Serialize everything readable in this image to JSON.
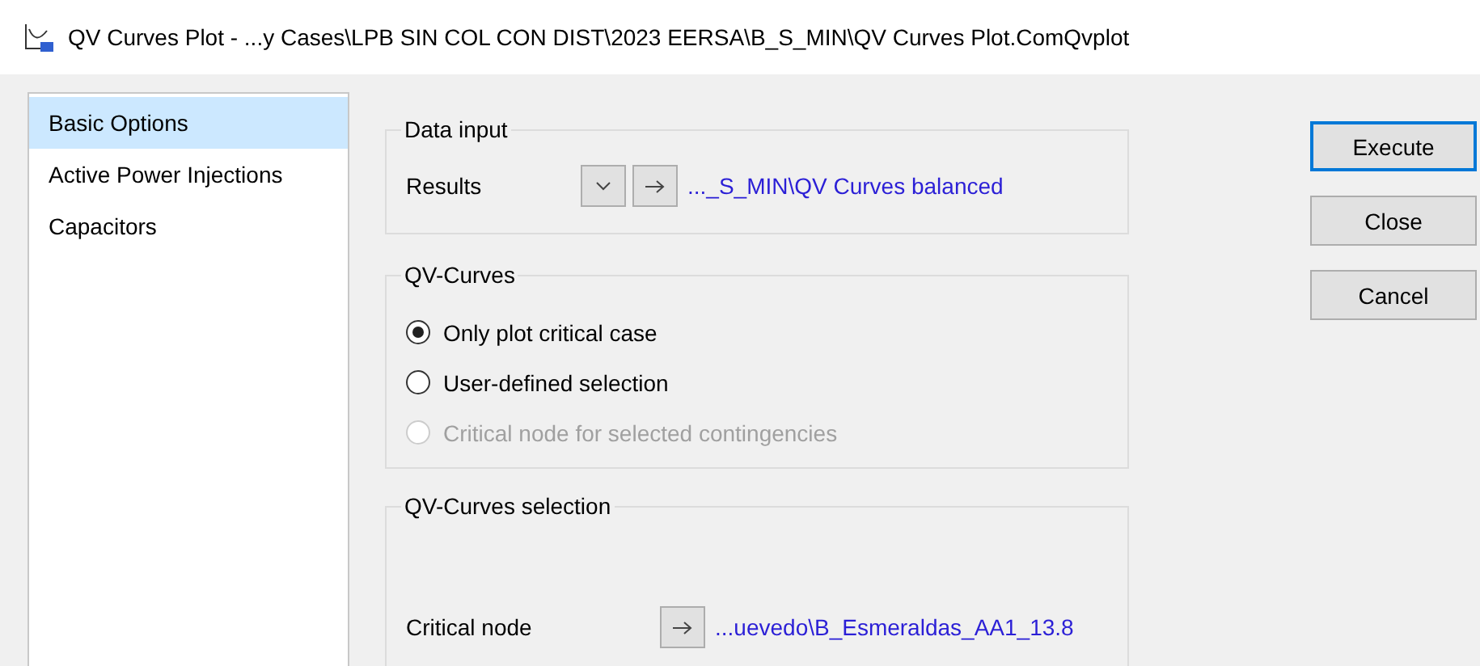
{
  "window": {
    "title": "QV Curves Plot - ...y Cases\\LPB SIN COL CON DIST\\2023 EERSA\\B_S_MIN\\QV Curves Plot.ComQvplot"
  },
  "sidebar": {
    "items": [
      {
        "label": "Basic Options",
        "selected": true
      },
      {
        "label": "Active Power Injections",
        "selected": false
      },
      {
        "label": "Capacitors",
        "selected": false
      }
    ]
  },
  "data_input": {
    "title": "Data input",
    "label": "Results",
    "controls": [
      {
        "kind": "dropdown"
      },
      {
        "kind": "jump"
      }
    ],
    "value": "..._S_MIN\\QV Curves balanced"
  },
  "qv_curves": {
    "title": "QV-Curves",
    "options": [
      {
        "label": "Only plot critical case",
        "selected": true,
        "disabled": false
      },
      {
        "label": "User-defined selection",
        "selected": false,
        "disabled": false
      },
      {
        "label": "Critical node for selected contingencies",
        "selected": false,
        "disabled": true
      }
    ]
  },
  "qv_selection": {
    "title": "QV-Curves selection",
    "label": "Critical node",
    "controls": [
      {
        "kind": "jump"
      }
    ],
    "value": "...uevedo\\B_Esmeraldas_AA1_13.8"
  },
  "buttons": [
    {
      "label": "Execute",
      "default": true
    },
    {
      "label": "Close",
      "default": false
    },
    {
      "label": "Cancel",
      "default": false
    }
  ]
}
